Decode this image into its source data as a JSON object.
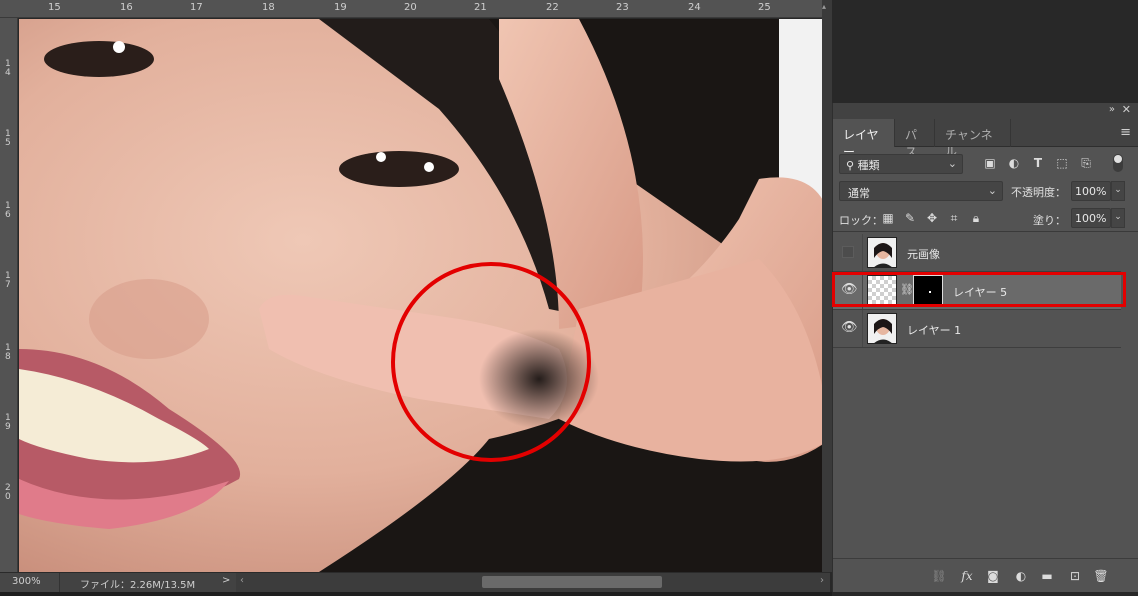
{
  "ruler": {
    "top_labels": [
      "15",
      "16",
      "17",
      "18",
      "19",
      "20",
      "21",
      "22",
      "23",
      "24",
      "25"
    ],
    "left_labels": [
      "14",
      "15",
      "16",
      "17",
      "18",
      "19",
      "20"
    ]
  },
  "status": {
    "zoom": "300%",
    "file_info": "ファイル：2.26M/13.5M",
    "arrow": ">"
  },
  "panel": {
    "tabs": [
      {
        "label": "レイヤー",
        "active": true
      },
      {
        "label": "パス",
        "active": false
      },
      {
        "label": "チャンネル",
        "active": false
      }
    ],
    "filter": {
      "label": "種類"
    },
    "blend_mode": "通常",
    "opacity_label": "不透明度：",
    "opacity_value": "100%",
    "lock_label": "ロック：",
    "fill_label": "塗り：",
    "fill_value": "100%",
    "layers": [
      {
        "name": "元画像",
        "visible": false,
        "selected": false,
        "has_mask": false
      },
      {
        "name": "レイヤー 5",
        "visible": true,
        "selected": true,
        "has_mask": true
      },
      {
        "name": "レイヤー 1",
        "visible": true,
        "selected": false,
        "has_mask": false
      }
    ]
  },
  "colors": {
    "annotation_red": "#e30000",
    "panel_bg": "#535353",
    "selected_layer_bg": "#6a6a6a"
  }
}
